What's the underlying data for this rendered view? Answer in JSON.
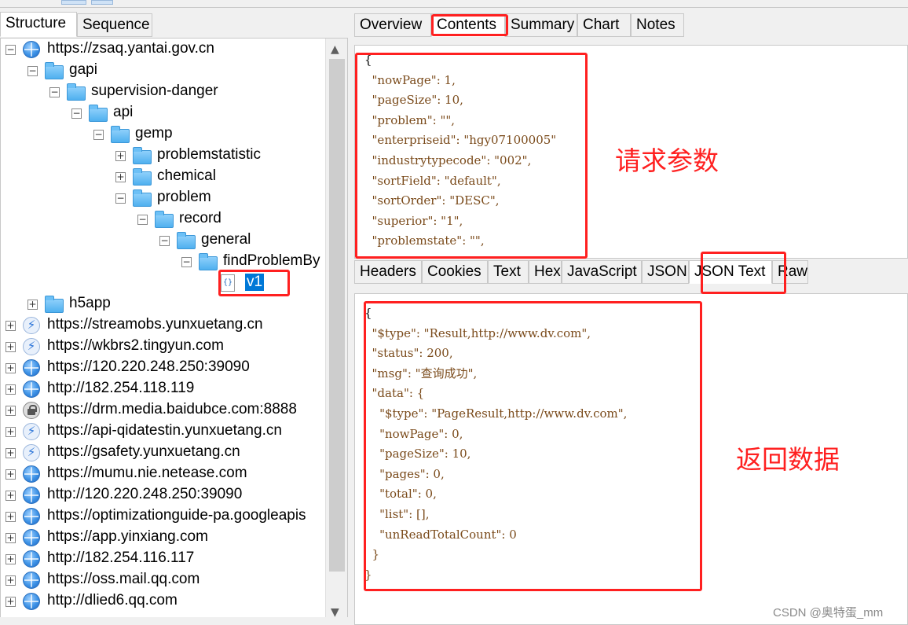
{
  "left_tabs": [
    {
      "label": "Structure",
      "active": true
    },
    {
      "label": "Sequence",
      "active": false
    }
  ],
  "tree": [
    {
      "label": "https://zsaq.yantai.gov.cn",
      "icon": "globe-icon",
      "exp": "−",
      "level": 0
    },
    {
      "label": "gapi",
      "icon": "folder-icon",
      "exp": "−",
      "level": 1
    },
    {
      "label": "supervision-danger",
      "icon": "folder-icon",
      "exp": "−",
      "level": 2
    },
    {
      "label": "api",
      "icon": "folder-icon",
      "exp": "−",
      "level": 3
    },
    {
      "label": "gemp",
      "icon": "folder-icon",
      "exp": "−",
      "level": 4
    },
    {
      "label": "problemstatistic",
      "icon": "folder-icon",
      "exp": "+",
      "level": 5
    },
    {
      "label": "chemical",
      "icon": "folder-icon",
      "exp": "+",
      "level": 5
    },
    {
      "label": "problem",
      "icon": "folder-icon",
      "exp": "−",
      "level": 5
    },
    {
      "label": "record",
      "icon": "folder-icon",
      "exp": "−",
      "level": 6
    },
    {
      "label": "general",
      "icon": "folder-icon",
      "exp": "−",
      "level": 7
    },
    {
      "label": "findProblemBy",
      "icon": "folder-icon",
      "exp": "−",
      "level": 8
    },
    {
      "label": "v1",
      "icon": "file-icon",
      "exp": "",
      "level": 9,
      "selected": true
    },
    {
      "label": "h5app",
      "icon": "folder-icon",
      "exp": "+",
      "level": 1
    },
    {
      "label": "https://streamobs.yunxuetang.cn",
      "icon": "bolt-icon",
      "exp": "+",
      "level": 0
    },
    {
      "label": "https://wkbrs2.tingyun.com",
      "icon": "bolt-icon",
      "exp": "+",
      "level": 0
    },
    {
      "label": "https://120.220.248.250:39090",
      "icon": "globe-icon",
      "exp": "+",
      "level": 0
    },
    {
      "label": "http://182.254.118.119",
      "icon": "globe-icon",
      "exp": "+",
      "level": 0
    },
    {
      "label": "https://drm.media.baidubce.com:8888",
      "icon": "lock-icon",
      "exp": "+",
      "level": 0
    },
    {
      "label": "https://api-qidatestin.yunxuetang.cn",
      "icon": "bolt-icon",
      "exp": "+",
      "level": 0
    },
    {
      "label": "https://gsafety.yunxuetang.cn",
      "icon": "bolt-icon",
      "exp": "+",
      "level": 0
    },
    {
      "label": "https://mumu.nie.netease.com",
      "icon": "globe-icon",
      "exp": "+",
      "level": 0
    },
    {
      "label": "http://120.220.248.250:39090",
      "icon": "globe-icon",
      "exp": "+",
      "level": 0
    },
    {
      "label": "https://optimizationguide-pa.googleapis",
      "icon": "globe-icon",
      "exp": "+",
      "level": 0
    },
    {
      "label": "https://app.yinxiang.com",
      "icon": "globe-icon",
      "exp": "+",
      "level": 0
    },
    {
      "label": "http://182.254.116.117",
      "icon": "globe-icon",
      "exp": "+",
      "level": 0
    },
    {
      "label": "https://oss.mail.qq.com",
      "icon": "globe-icon",
      "exp": "+",
      "level": 0
    },
    {
      "label": "http://dlied6.qq.com",
      "icon": "globe-icon",
      "exp": "+",
      "level": 0
    }
  ],
  "right_top_tabs": [
    {
      "label": "Overview"
    },
    {
      "label": "Contents",
      "active": true
    },
    {
      "label": "Summary"
    },
    {
      "label": "Chart"
    },
    {
      "label": "Notes"
    }
  ],
  "right_mid_tabs": [
    {
      "label": "Headers"
    },
    {
      "label": "Cookies"
    },
    {
      "label": "Text"
    },
    {
      "label": "Hex"
    },
    {
      "label": "JavaScript"
    },
    {
      "label": "JSON"
    },
    {
      "label": "JSON Text",
      "active": true
    },
    {
      "label": "Raw"
    }
  ],
  "request_lines": [
    "{",
    "  \"nowPage\": 1,",
    "  \"pageSize\": 10,",
    "  \"problem\": \"\",",
    "  \"enterpriseid\": \"hgy07100005\"",
    "  \"industrytypecode\": \"002\",",
    "  \"sortField\": \"default\",",
    "  \"sortOrder\": \"DESC\",",
    "  \"superior\": \"1\",",
    "  \"problemstate\": \"\","
  ],
  "response_lines": [
    "{",
    "  \"$type\": \"Result,http://www.dv.com\",",
    "  \"status\": 200,",
    "  \"msg\": \"查询成功\",",
    "  \"data\": {",
    "    \"$type\": \"PageResult,http://www.dv.com\",",
    "    \"nowPage\": 0,",
    "    \"pageSize\": 10,",
    "    \"pages\": 0,",
    "    \"total\": 0,",
    "    \"list\": [],",
    "    \"unReadTotalCount\": 0",
    "  }",
    "}"
  ],
  "annotations": {
    "request_label": "请求参数",
    "response_label": "返回数据"
  },
  "watermark": "CSDN @奥特蛋_mm",
  "accent_color": "#ff2020"
}
